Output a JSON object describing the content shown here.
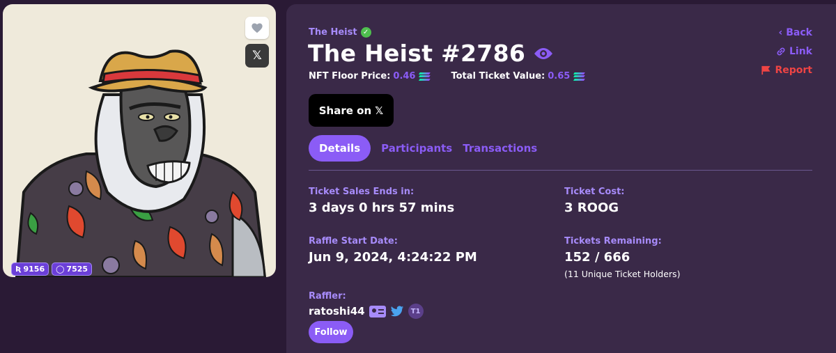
{
  "nft": {
    "rank_badges": [
      {
        "icon": "rarity-r-icon",
        "value": "9156"
      },
      {
        "icon": "rarity-o-icon",
        "value": "7525"
      }
    ],
    "x_label": "𝕏"
  },
  "collection": {
    "name": "The Heist"
  },
  "title": "The Heist #2786",
  "prices": {
    "floor_label": "NFT Floor Price:",
    "floor_value": "0.46",
    "ticket_value_label": "Total Ticket Value:",
    "ticket_value": "0.65"
  },
  "side_links": {
    "back": "Back",
    "link": "Link",
    "report": "Report"
  },
  "share": {
    "label": "Share on",
    "x": "𝕏"
  },
  "tabs": [
    {
      "label": "Details"
    },
    {
      "label": "Participants"
    },
    {
      "label": "Transactions"
    }
  ],
  "details": {
    "sales_end_label": "Ticket Sales Ends in:",
    "sales_end_value": "3 days 0 hrs 57 mins",
    "ticket_cost_label": "Ticket Cost:",
    "ticket_cost_value": "3 ROOG",
    "start_date_label": "Raffle Start Date:",
    "start_date_value": "Jun 9, 2024, 4:24:22 PM",
    "remaining_label": "Tickets Remaining:",
    "remaining_value": "152 / 666",
    "remaining_sub": "(11 Unique Ticket Holders)",
    "raffler_label": "Raffler:",
    "raffler_name": "ratoshi44",
    "raffler_tier": "T1",
    "follow": "Follow"
  },
  "colors": {
    "accent": "#8b5cf6",
    "report": "#ef4444",
    "panel": "#3a2948",
    "background": "#2a1a35"
  }
}
